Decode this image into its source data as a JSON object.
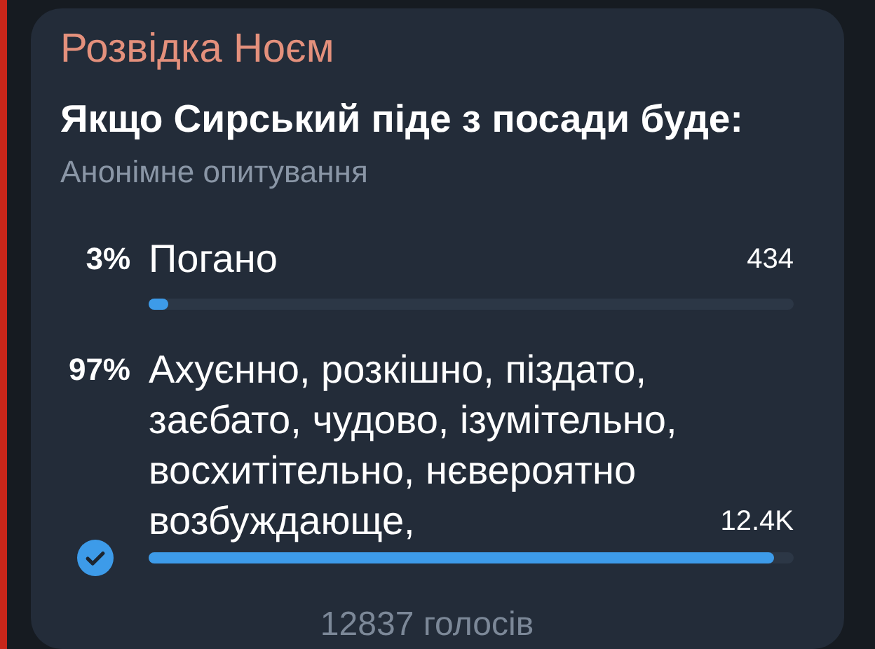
{
  "channel": "Розвідка Ноєм",
  "question": "Якщо Сирський піде з посади буде:",
  "poll_type": "Анонімне опитування",
  "options": [
    {
      "percent": "3%",
      "text": "Погано",
      "count": "434",
      "level": 0.03,
      "selected": false
    },
    {
      "percent": "97%",
      "text": "Ахуєнно, розкішно, піздато, заєбато, чудово, ізумітельно, восхитітельно, нєвероятно возбуждающе,",
      "count": "12.4K",
      "level": 0.97,
      "selected": true
    }
  ],
  "total_votes": "12837 голосів"
}
